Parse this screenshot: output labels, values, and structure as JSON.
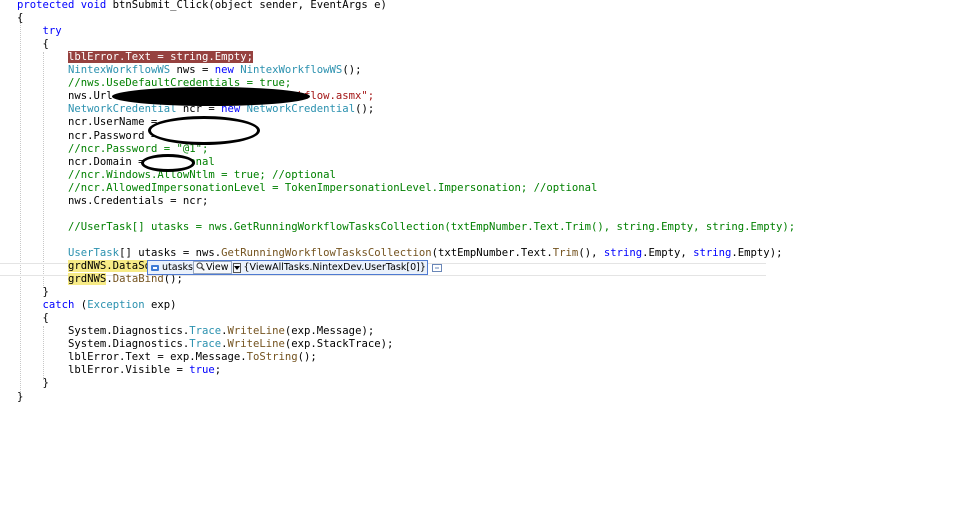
{
  "code": {
    "lines": [
      [
        [
          "kw",
          "protected "
        ],
        [
          "kw",
          "void "
        ],
        [
          "pl",
          "btnSubmit_Click(object sender, EventArgs e)"
        ]
      ],
      [
        [
          "pl",
          "{"
        ]
      ],
      [
        [
          "pl",
          "    "
        ],
        [
          "kw",
          "try"
        ]
      ],
      [
        [
          "pl",
          "    {"
        ]
      ],
      [
        [
          "pl",
          "        "
        ],
        [
          "bp",
          "lblError.Text = string.Empty;"
        ]
      ],
      [
        [
          "pl",
          "        "
        ],
        [
          "ty",
          "NintexWorkflowWS"
        ],
        [
          "pl",
          " nws = "
        ],
        [
          "kw",
          "new "
        ],
        [
          "ty",
          "NintexWorkflowWS"
        ],
        [
          "pl",
          "();"
        ]
      ],
      [
        [
          "pl",
          "        "
        ],
        [
          "cm",
          "//nws.UseDefaultCredentials = true;"
        ]
      ],
      [
        [
          "pl",
          "        nws.Url = "
        ],
        [
          "st",
          "vti_bin/NintexWorkflow/Workflow.asmx\";"
        ]
      ],
      [
        [
          "pl",
          "        "
        ],
        [
          "ty",
          "NetworkCredential"
        ],
        [
          "pl",
          " ncr = "
        ],
        [
          "kw",
          "new "
        ],
        [
          "ty",
          "NetworkCredential"
        ],
        [
          "pl",
          "();"
        ]
      ],
      [
        [
          "pl",
          "        ncr.UserName = "
        ]
      ],
      [
        [
          "pl",
          "        ncr.Password = "
        ]
      ],
      [
        [
          "pl",
          "        "
        ],
        [
          "cm",
          "//ncr.Password = \"@1\";"
        ]
      ],
      [
        [
          "pl",
          "        ncr.Domain = "
        ],
        [
          "cm",
          "//optional"
        ]
      ],
      [
        [
          "pl",
          "        "
        ],
        [
          "cm",
          "//ncr.Windows.AllowNtlm = true; //optional"
        ]
      ],
      [
        [
          "pl",
          "        "
        ],
        [
          "cm",
          "//ncr.AllowedImpersonationLevel = TokenImpersonationLevel.Impersonation; //optional"
        ]
      ],
      [
        [
          "pl",
          "        nws.Credentials = ncr;"
        ]
      ],
      [
        [
          "pl",
          ""
        ]
      ],
      [
        [
          "pl",
          "        "
        ],
        [
          "cm",
          "//UserTask[] utasks = nws.GetRunningWorkflowTasksCollection(txtEmpNumber.Text.Trim(), string.Empty, string.Empty);"
        ]
      ],
      [
        [
          "pl",
          ""
        ]
      ],
      [
        [
          "pl",
          "        "
        ],
        [
          "ty",
          "UserTask"
        ],
        [
          "pl",
          "[] utasks = nws."
        ],
        [
          "fn",
          "GetRunningWorkflowTasksCollection"
        ],
        [
          "pl",
          "(txtEmpNumber.Text."
        ],
        [
          "fn",
          "Trim"
        ],
        [
          "pl",
          "(), "
        ],
        [
          "kw",
          "string"
        ],
        [
          "pl",
          ".Empty, "
        ],
        [
          "kw",
          "string"
        ],
        [
          "pl",
          ".Empty);"
        ]
      ],
      [
        [
          "pl",
          "        "
        ],
        [
          "hl",
          "grdNWS.DataSou"
        ]
      ],
      [
        [
          "pl",
          "        "
        ],
        [
          "hl",
          "grdNWS"
        ],
        [
          "pl",
          "."
        ],
        [
          "fn",
          "DataBind"
        ],
        [
          "pl",
          "();"
        ]
      ],
      [
        [
          "pl",
          "    }"
        ]
      ],
      [
        [
          "pl",
          "    "
        ],
        [
          "kw",
          "catch "
        ],
        [
          "pl",
          "("
        ],
        [
          "ty",
          "Exception"
        ],
        [
          "pl",
          " exp)"
        ]
      ],
      [
        [
          "pl",
          "    {"
        ]
      ],
      [
        [
          "pl",
          "        System.Diagnostics."
        ],
        [
          "ty",
          "Trace"
        ],
        [
          "pl",
          "."
        ],
        [
          "fn",
          "WriteLine"
        ],
        [
          "pl",
          "(exp.Message);"
        ]
      ],
      [
        [
          "pl",
          "        System.Diagnostics."
        ],
        [
          "ty",
          "Trace"
        ],
        [
          "pl",
          "."
        ],
        [
          "fn",
          "WriteLine"
        ],
        [
          "pl",
          "(exp.StackTrace);"
        ]
      ],
      [
        [
          "pl",
          "        lblError.Text = exp.Message."
        ],
        [
          "fn",
          "ToString"
        ],
        [
          "pl",
          "();"
        ]
      ],
      [
        [
          "pl",
          "        lblError.Visible = "
        ],
        [
          "kw",
          "true"
        ],
        [
          "pl",
          ";"
        ]
      ],
      [
        [
          "pl",
          "    }"
        ]
      ],
      [
        [
          "pl",
          "}"
        ]
      ]
    ]
  },
  "datatip": {
    "variable": "utasks",
    "viewer_label": "View",
    "value": "{ViewAllTasks.NintexDev.UserTask[0]}",
    "icon": "variable-icon",
    "expand_icon": "expand-icon"
  },
  "colors": {
    "keyword": "#0000ff",
    "type": "#2b91af",
    "comment": "#008000",
    "string": "#a31515",
    "method": "#74531f",
    "breakpoint": "#96413f",
    "current_statement": "#f7eb86",
    "datatip_border": "#4f7ad1"
  }
}
